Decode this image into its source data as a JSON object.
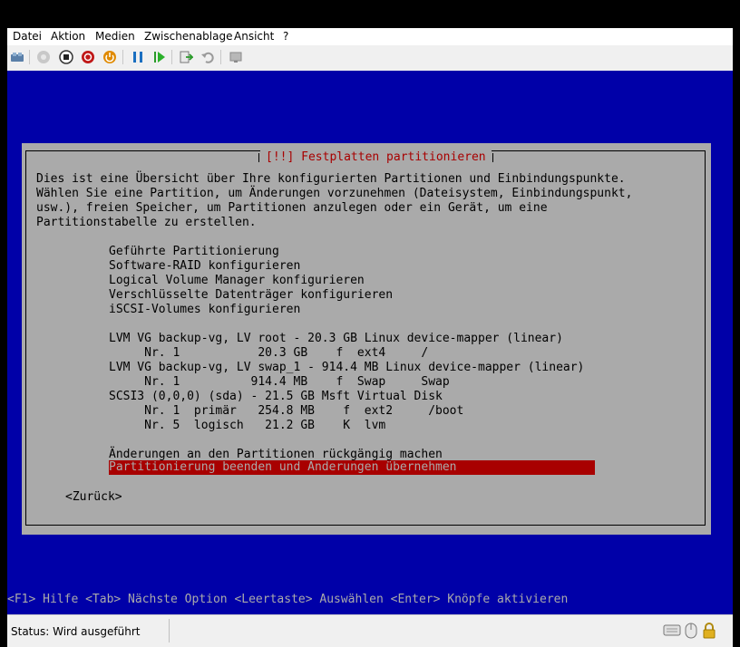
{
  "menu": {
    "items": [
      "Datei",
      "Aktion",
      "Medien",
      "Zwischenablage",
      "Ansicht",
      "?"
    ]
  },
  "toolbar": {
    "icons": [
      "ctrl-alt-del-icon",
      "start-icon",
      "turn-off-icon",
      "shutdown-icon",
      "power-icon",
      "pause-icon",
      "reset-icon",
      "checkpoint-icon",
      "revert-icon",
      "enhanced-session-icon"
    ]
  },
  "dialog": {
    "title": "[!!] Festplatten partitionieren",
    "description": [
      "Dies ist eine Übersicht über Ihre konfigurierten Partitionen und Einbindungspunkte.",
      "Wählen Sie eine Partition, um Änderungen vorzunehmen (Dateisystem, Einbindungspunkt,",
      "usw.), freien Speicher, um Partitionen anzulegen oder ein Gerät, um eine",
      "Partitionstabelle zu erstellen."
    ],
    "options": [
      "Geführte Partitionierung",
      "Software-RAID konfigurieren",
      "Logical Volume Manager konfigurieren",
      "Verschlüsselte Datenträger konfigurieren",
      "iSCSI-Volumes konfigurieren"
    ],
    "partitions": [
      "LVM VG backup-vg, LV root - 20.3 GB Linux device-mapper (linear)",
      "     Nr. 1           20.3 GB    f  ext4     /",
      "LVM VG backup-vg, LV swap_1 - 914.4 MB Linux device-mapper (linear)",
      "     Nr. 1          914.4 MB    f  Swap     Swap",
      "SCSI3 (0,0,0) (sda) - 21.5 GB Msft Virtual Disk",
      "     Nr. 1  primär   254.8 MB    f  ext2     /boot",
      "     Nr. 5  logisch   21.2 GB    K  lvm"
    ],
    "undo": "Änderungen an den Partitionen rückgängig machen",
    "finish": "Partitionierung beenden und Änderungen übernehmen",
    "back": "<Zurück>"
  },
  "help_line": "<F1> Hilfe <Tab> Nächste Option <Leertaste> Auswählen <Enter> Knöpfe aktivieren",
  "status": {
    "text": "Status: Wird ausgeführt",
    "icons": [
      "keyboard-icon",
      "mouse-icon",
      "lock-icon"
    ]
  },
  "colors": {
    "screen_bg": "#0000a8",
    "dialog_bg": "#aaaaaa",
    "title_red": "#a80000",
    "selection_bg": "#a80000"
  }
}
